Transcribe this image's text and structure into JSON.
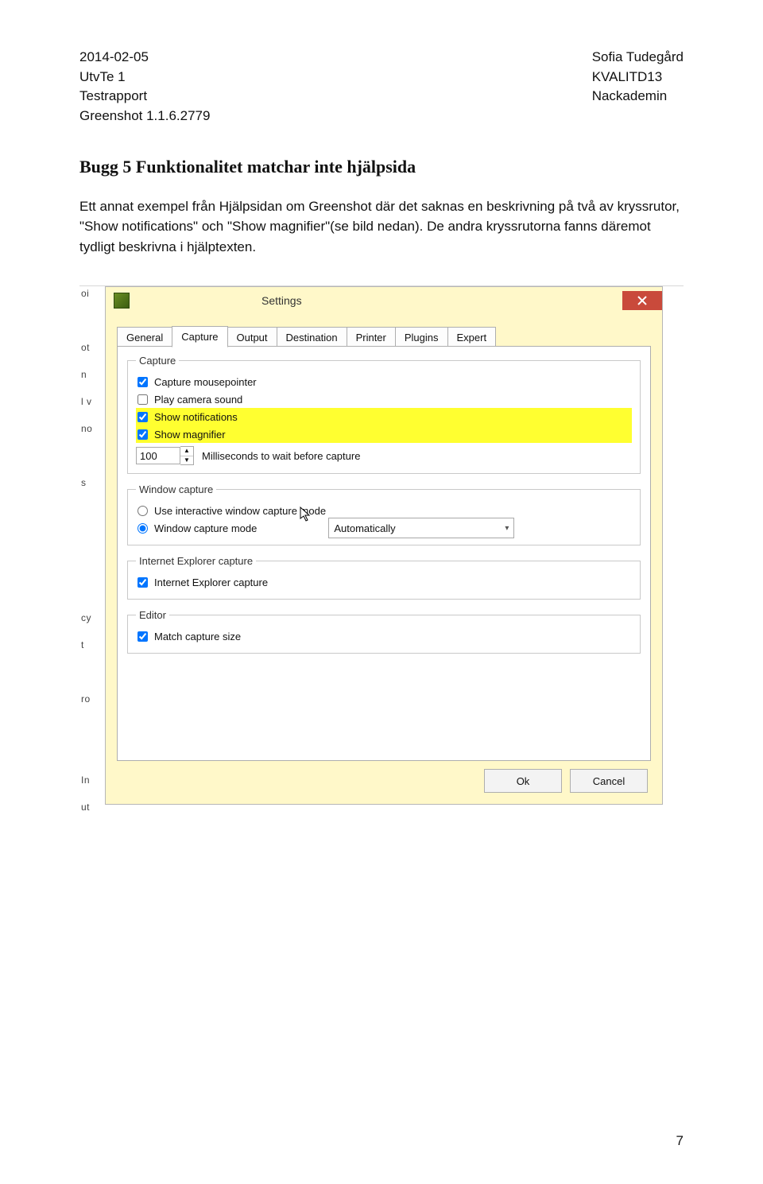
{
  "header": {
    "left": {
      "date": "2014-02-05",
      "line2": "UtvTe 1",
      "line3": "Testrapport",
      "line4": "Greenshot 1.1.6.2779"
    },
    "right": {
      "name": "Sofia Tudegård",
      "line2": "KVALITD13",
      "line3": "Nackademin"
    }
  },
  "heading": "Bugg 5 Funktionalitet matchar inte hjälpsida",
  "body": "Ett annat exempel från Hjälpsidan om Greenshot där det saknas en beskrivning på två av kryssrutor, \"Show notifications\" och \"Show magnifier\"(se bild nedan). De andra kryssrutorna fanns däremot tydligt beskrivna i hjälptexten.",
  "page_number": "7",
  "edge_lines": [
    "oi",
    " ",
    "ot",
    "n",
    "l v",
    "no",
    " ",
    "s",
    " ",
    " ",
    " ",
    " ",
    "cy",
    "t",
    " ",
    "ro",
    " ",
    " ",
    "In",
    "ut"
  ],
  "settings": {
    "title": "Settings",
    "tabs": [
      "General",
      "Capture",
      "Output",
      "Destination",
      "Printer",
      "Plugins",
      "Expert"
    ],
    "active_tab": 1,
    "capture": {
      "legend": "Capture",
      "mousepointer": {
        "label": "Capture mousepointer",
        "checked": true
      },
      "camera": {
        "label": "Play camera sound",
        "checked": false
      },
      "notifications": {
        "label": "Show notifications",
        "checked": true
      },
      "magnifier": {
        "label": "Show magnifier",
        "checked": true
      },
      "ms_value": "100",
      "ms_label": "Milliseconds to wait before capture"
    },
    "window_capture": {
      "legend": "Window capture",
      "interactive": {
        "label": "Use interactive window capture mode",
        "checked": false
      },
      "mode": {
        "label": "Window capture mode",
        "checked": true
      },
      "select_value": "Automatically"
    },
    "ie_capture": {
      "legend": "Internet Explorer capture",
      "ie": {
        "label": "Internet Explorer capture",
        "checked": true
      }
    },
    "editor": {
      "legend": "Editor",
      "match": {
        "label": "Match capture size",
        "checked": true
      }
    },
    "buttons": {
      "ok": "Ok",
      "cancel": "Cancel"
    }
  }
}
